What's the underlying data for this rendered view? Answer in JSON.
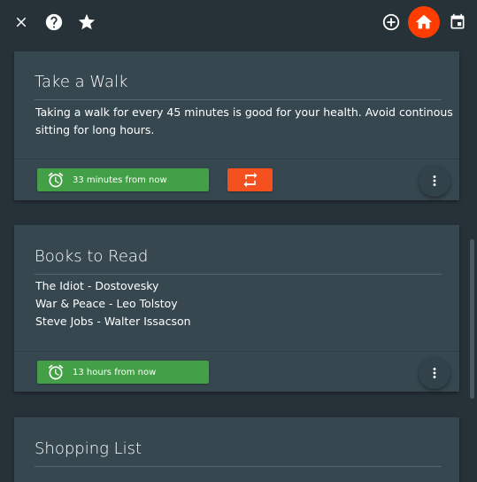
{
  "toolbar": {
    "left_icons": [
      "close-icon",
      "help-icon",
      "star-icon"
    ],
    "right_icons": [
      "add-circle-icon",
      "home-icon",
      "calendar-icon"
    ],
    "active_icon": "home-icon",
    "accent_color": "#ff3d00"
  },
  "cards": [
    {
      "title": "Take a Walk",
      "body": [
        "Taking a walk for every 45 minutes is good for your health. Avoid continous",
        "sitting for long hours."
      ],
      "reminder": "33 minutes from now",
      "repeat": true
    },
    {
      "title": "Books to Read",
      "body": [
        "The Idiot - Dostovesky",
        "War & Peace - Leo Tolstoy",
        "Steve Jobs - Walter Issacson"
      ],
      "reminder": "13 hours from now",
      "repeat": false
    },
    {
      "title": "Shopping List"
    }
  ],
  "colors": {
    "background": "#263238",
    "card": "#37474f",
    "reminder": "#43a047",
    "repeat": "#f4511e"
  }
}
